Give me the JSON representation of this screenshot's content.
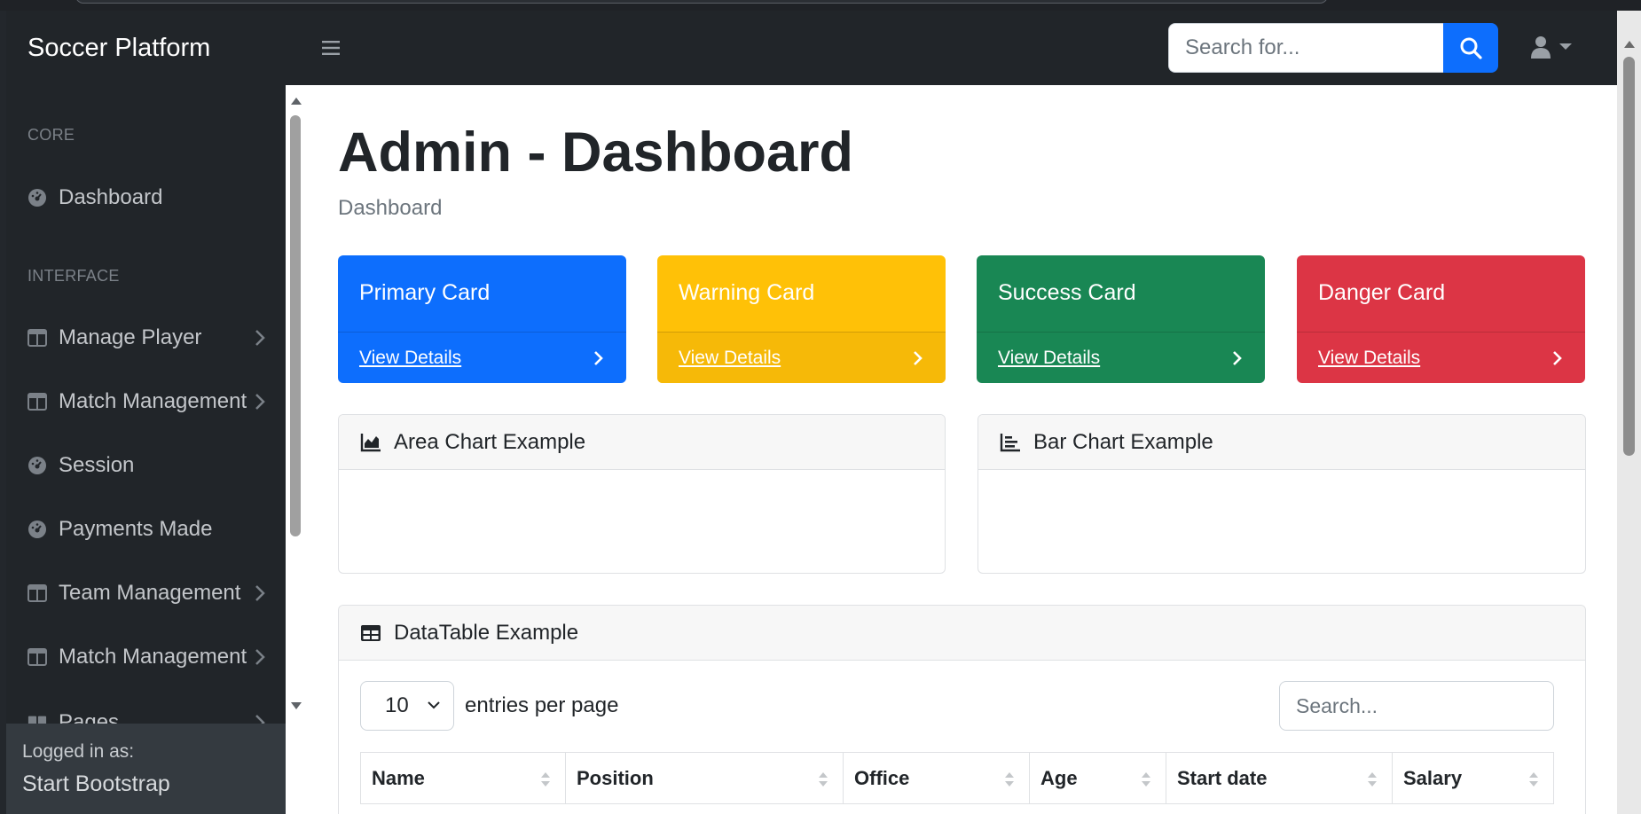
{
  "brand": "Soccer Platform",
  "navbar": {
    "search_placeholder": "Search for..."
  },
  "sidebar": {
    "headings": {
      "core": "CORE",
      "interface": "INTERFACE"
    },
    "items": [
      {
        "label": "Dashboard",
        "icon": "gauge-icon",
        "chevron": false
      },
      {
        "label": "Manage Player",
        "icon": "columns-icon",
        "chevron": true
      },
      {
        "label": "Match Management",
        "icon": "columns-icon",
        "chevron": true
      },
      {
        "label": "Session",
        "icon": "gauge-icon",
        "chevron": false
      },
      {
        "label": "Payments Made",
        "icon": "gauge-icon",
        "chevron": false
      },
      {
        "label": "Team Management",
        "icon": "columns-icon",
        "chevron": true
      },
      {
        "label": "Match Management",
        "icon": "columns-icon",
        "chevron": true
      },
      {
        "label": "Pages",
        "icon": "book-icon",
        "chevron": true
      }
    ],
    "footer": {
      "small": "Logged in as:",
      "name": "Start Bootstrap"
    }
  },
  "main": {
    "title": "Admin - Dashboard",
    "breadcrumb": "Dashboard",
    "cards": [
      {
        "title": "Primary Card",
        "link": "View Details",
        "color": "#0d6efd"
      },
      {
        "title": "Warning Card",
        "link": "View Details",
        "color": "#ffc107"
      },
      {
        "title": "Success Card",
        "link": "View Details",
        "color": "#198754"
      },
      {
        "title": "Danger Card",
        "link": "View Details",
        "color": "#dc3545"
      }
    ],
    "area_chart": {
      "title": "Area Chart Example"
    },
    "bar_chart": {
      "title": "Bar Chart Example"
    },
    "datatable": {
      "title": "DataTable Example",
      "per_page_value": "10",
      "per_page_label": "entries per page",
      "search_placeholder": "Search...",
      "columns": [
        "Name",
        "Position",
        "Office",
        "Age",
        "Start date",
        "Salary"
      ]
    }
  }
}
